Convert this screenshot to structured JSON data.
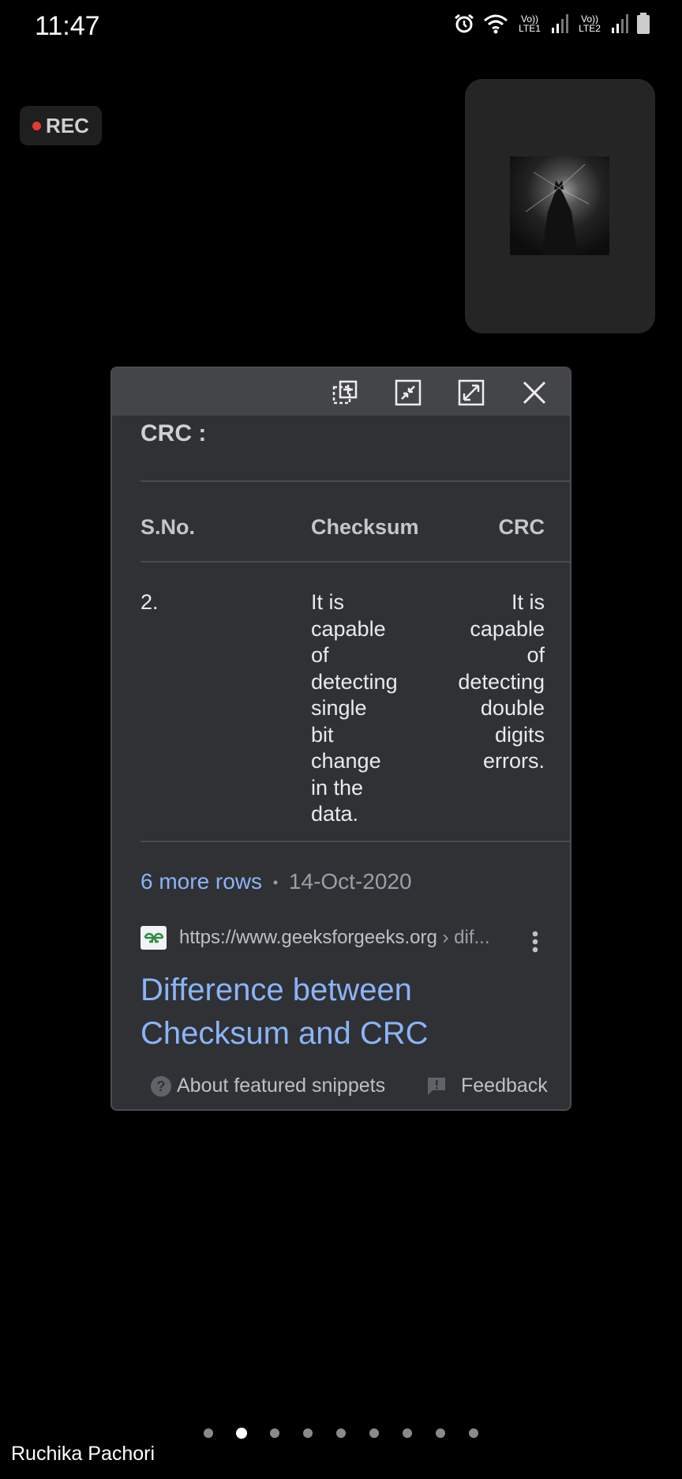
{
  "status_bar": {
    "time": "11:47",
    "sim1_label": "Vo)) LTE1",
    "sim2_label": "Vo)) LTE2",
    "icons": [
      "alarm-icon",
      "wifi-icon",
      "signal-icon",
      "signal-icon",
      "battery-icon"
    ]
  },
  "recording": {
    "label": "REC",
    "dot_color": "#e53935"
  },
  "popup": {
    "toolbar": {
      "icons": [
        "copy-window-icon",
        "minimize-icon",
        "maximize-icon",
        "close-icon"
      ]
    },
    "section_title": "CRC :",
    "table": {
      "headers": [
        "S.No.",
        "Checksum",
        "CRC"
      ],
      "row": {
        "sno": "2.",
        "checksum_lines": [
          "It is",
          "capable",
          "of",
          "detecting",
          "single",
          "bit",
          "change",
          "in the",
          "data."
        ],
        "crc_lines": [
          "It is",
          "capable",
          "of",
          "detecting",
          "double",
          "digits",
          "errors."
        ]
      }
    },
    "more_rows": "6 more rows",
    "separator": "•",
    "date": "14-Oct-2020",
    "source_url": "https://www.geeksforgeeks.org",
    "source_path": " › dif...",
    "result_title_line1": "Difference between",
    "result_title_line2": "Checksum and CRC",
    "footer": {
      "about_label": "About featured snippets",
      "feedback_label": "Feedback"
    },
    "link_color": "#8ab4f8"
  },
  "pagination": {
    "count": 9,
    "active_index": 1
  },
  "owner_name": "Ruchika Pachori"
}
